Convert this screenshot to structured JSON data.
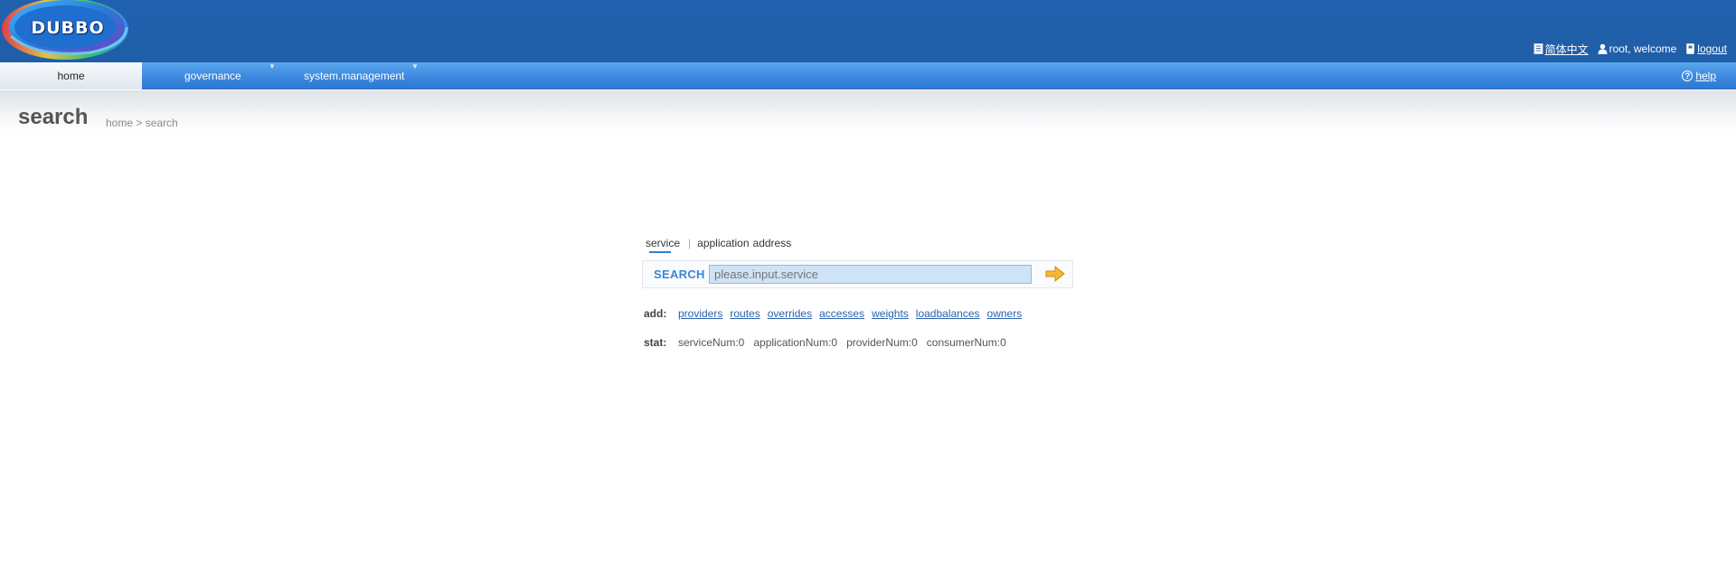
{
  "header": {
    "logo_text": "DUBBO",
    "language_link": "简体中文",
    "welcome_text": "root, welcome",
    "logout_link": "logout"
  },
  "nav": {
    "items": [
      {
        "label": "home",
        "active": true,
        "dropdown": false
      },
      {
        "label": "governance",
        "active": false,
        "dropdown": true
      },
      {
        "label": "system.management",
        "active": false,
        "dropdown": true
      }
    ],
    "help_link": "help"
  },
  "page": {
    "title": "search",
    "breadcrumb": "home > search"
  },
  "search": {
    "tabs": [
      "service",
      "application",
      "address"
    ],
    "tab_separator": "|",
    "label": "SEARCH",
    "placeholder": "please.input.service"
  },
  "add_row": {
    "label": "add:",
    "links": [
      "providers",
      "routes",
      "overrides",
      "accesses",
      "weights",
      "loadbalances",
      "owners"
    ]
  },
  "stat_row": {
    "label": "stat:",
    "values": [
      "serviceNum:0",
      "applicationNum:0",
      "providerNum:0",
      "consumerNum:0"
    ]
  },
  "colors": {
    "header_bg": "#2160ad",
    "nav_bg": "#3f8be0",
    "link": "#2a62ad",
    "search_label": "#3a86d5",
    "search_input_bg": "#cfe3f6"
  },
  "icons": [
    "document-icon",
    "user-icon",
    "logout-icon",
    "help-icon",
    "arrow-right-icon",
    "dropdown-arrow-icon"
  ]
}
